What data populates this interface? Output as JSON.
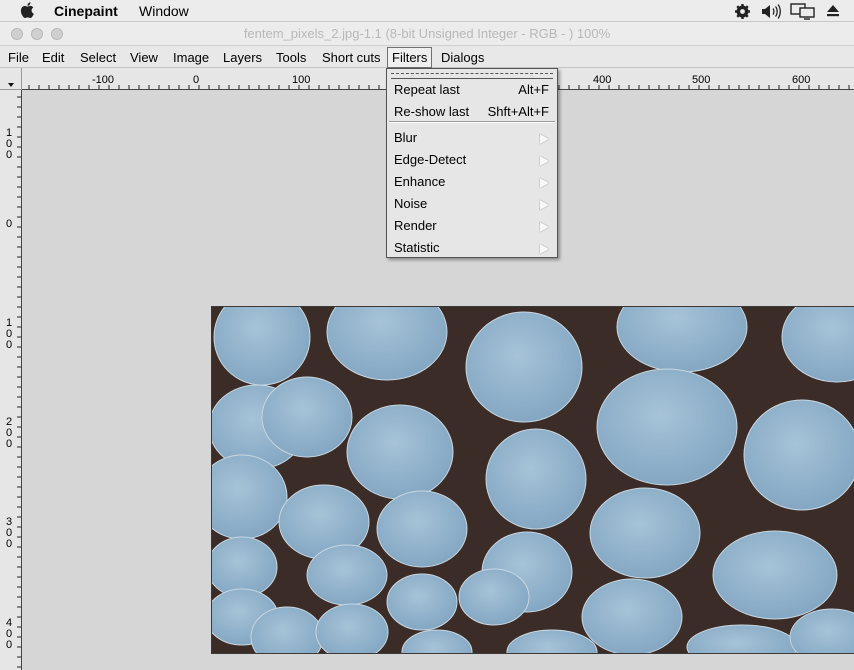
{
  "os": {
    "app_name": "Cinepaint",
    "menu_window": "Window"
  },
  "window": {
    "title": "fentem_pixels_2.jpg-1.1 (8-bit Unsigned Integer - RGB - ) 100%"
  },
  "menubar": {
    "items": [
      "File",
      "Edit",
      "Select",
      "View",
      "Image",
      "Layers",
      "Tools",
      "Short cuts",
      "Filters",
      "Dialogs"
    ]
  },
  "rulers": {
    "horizontal": [
      "-100",
      "0",
      "100",
      "400",
      "500",
      "600"
    ],
    "vertical": [
      [
        "1",
        "0",
        "0"
      ],
      [
        "0"
      ],
      [
        "1",
        "0",
        "0"
      ],
      [
        "2",
        "0",
        "0"
      ],
      [
        "3",
        "0",
        "0"
      ],
      [
        "4",
        "0",
        "0"
      ]
    ]
  },
  "filters_menu": {
    "repeat_last": {
      "label": "Repeat last",
      "accel": "Alt+F"
    },
    "reshow_last": {
      "label": "Re-show last",
      "accel": "Shft+Alt+F"
    },
    "submenus": [
      "Blur",
      "Edge-Detect",
      "Enhance",
      "Noise",
      "Render",
      "Statistic"
    ]
  },
  "colors": {
    "image_background": "#3b2c28",
    "disc_fill": "#8fb2cc",
    "canvas": "#d6d6d6"
  }
}
